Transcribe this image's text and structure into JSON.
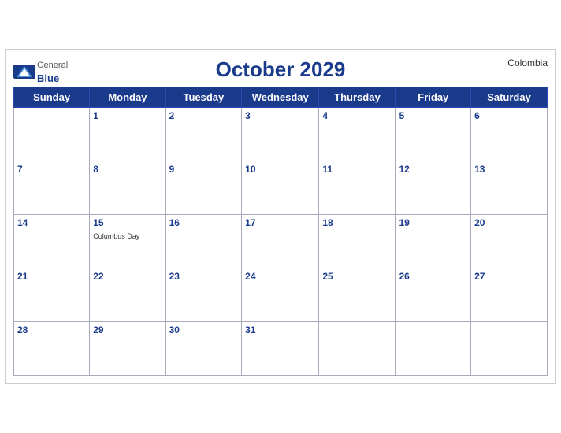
{
  "header": {
    "month_year": "October 2029",
    "country": "Colombia",
    "logo_general": "General",
    "logo_blue": "Blue"
  },
  "weekdays": [
    "Sunday",
    "Monday",
    "Tuesday",
    "Wednesday",
    "Thursday",
    "Friday",
    "Saturday"
  ],
  "weeks": [
    [
      {
        "day": "",
        "empty": true
      },
      {
        "day": "1",
        "event": ""
      },
      {
        "day": "2",
        "event": ""
      },
      {
        "day": "3",
        "event": ""
      },
      {
        "day": "4",
        "event": ""
      },
      {
        "day": "5",
        "event": ""
      },
      {
        "day": "6",
        "event": ""
      }
    ],
    [
      {
        "day": "7",
        "event": ""
      },
      {
        "day": "8",
        "event": ""
      },
      {
        "day": "9",
        "event": ""
      },
      {
        "day": "10",
        "event": ""
      },
      {
        "day": "11",
        "event": ""
      },
      {
        "day": "12",
        "event": ""
      },
      {
        "day": "13",
        "event": ""
      }
    ],
    [
      {
        "day": "14",
        "event": ""
      },
      {
        "day": "15",
        "event": "Columbus Day"
      },
      {
        "day": "16",
        "event": ""
      },
      {
        "day": "17",
        "event": ""
      },
      {
        "day": "18",
        "event": ""
      },
      {
        "day": "19",
        "event": ""
      },
      {
        "day": "20",
        "event": ""
      }
    ],
    [
      {
        "day": "21",
        "event": ""
      },
      {
        "day": "22",
        "event": ""
      },
      {
        "day": "23",
        "event": ""
      },
      {
        "day": "24",
        "event": ""
      },
      {
        "day": "25",
        "event": ""
      },
      {
        "day": "26",
        "event": ""
      },
      {
        "day": "27",
        "event": ""
      }
    ],
    [
      {
        "day": "28",
        "event": ""
      },
      {
        "day": "29",
        "event": ""
      },
      {
        "day": "30",
        "event": ""
      },
      {
        "day": "31",
        "event": ""
      },
      {
        "day": "",
        "empty": true
      },
      {
        "day": "",
        "empty": true
      },
      {
        "day": "",
        "empty": true
      }
    ]
  ]
}
